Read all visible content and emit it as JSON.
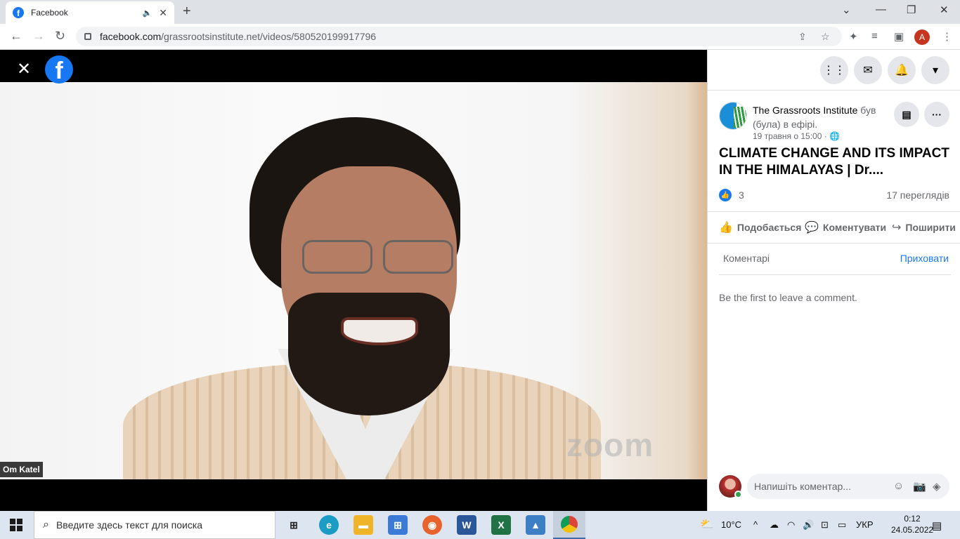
{
  "browser": {
    "tab_title": "Facebook",
    "url_host": "facebook.com",
    "url_path": "/grassrootsinstitute.net/videos/580520199917796",
    "profile_initial": "A"
  },
  "video": {
    "participant_name": "Om Katel",
    "watermark": "zoom"
  },
  "post": {
    "author": "The Grassroots Institute",
    "live_status": "був (була) в ефірі.",
    "date": "19 травня о 15:00 ·",
    "title": "CLIMATE CHANGE AND ITS IMPACT IN THE HIMALAYAS | Dr....",
    "likes": "3",
    "views": "17 переглядів"
  },
  "actions": {
    "like": "Подобається",
    "comment": "Коментувати",
    "share": "Поширити"
  },
  "comments": {
    "header": "Коментарі",
    "hide": "Приховати",
    "empty": "Be the first to leave a comment.",
    "placeholder": "Напишіть коментар..."
  },
  "taskbar": {
    "search_placeholder": "Введите здесь текст для поиска",
    "weather": "10°C",
    "lang": "УКР",
    "time": "0:12",
    "date": "24.05.2022"
  },
  "colors": {
    "facebook_blue": "#1877f2",
    "chrome_tabbar": "#dee1e6",
    "taskbar": "#dde5f0"
  }
}
